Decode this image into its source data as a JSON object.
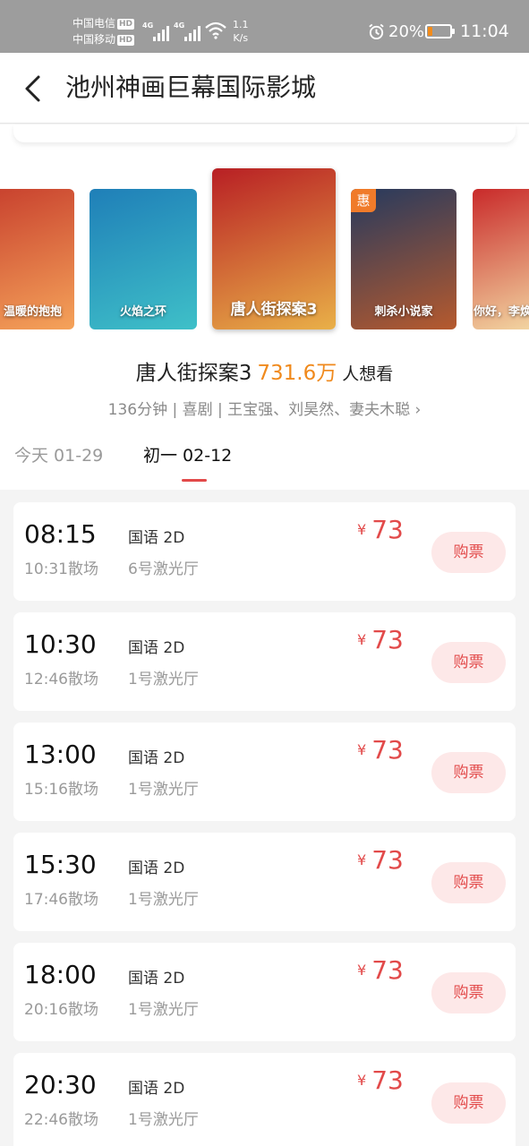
{
  "status_bar": {
    "carrier1": "中国电信",
    "carrier2": "中国移动",
    "hd": "HD",
    "net1": "4G",
    "net2": "4G",
    "speed_value": "1.1",
    "speed_unit": "K/s",
    "battery_pct": "20%",
    "battery_level": 0.2,
    "time": "11:04"
  },
  "header": {
    "title": "池州神画巨幕国际影城"
  },
  "posters": [
    {
      "label": "温暖的抱抱",
      "color1": "#c8412e",
      "color2": "#f5a35a"
    },
    {
      "label": "火焰之环",
      "color1": "#1f7fb8",
      "color2": "#3fc0c8"
    },
    {
      "label": "唐人街探案3",
      "color1": "#b81f24",
      "color2": "#e9b048"
    },
    {
      "label": "刺杀小说家",
      "color1": "#263a5e",
      "color2": "#b65a2e",
      "badge": "惠"
    },
    {
      "label": "你好，李焕英",
      "color1": "#c92a2a",
      "color2": "#f3d9a4"
    }
  ],
  "movie": {
    "name": "唐人街探案3",
    "want_count": "731.6万",
    "want_label": "人想看",
    "info": "136分钟 | 喜剧 | 王宝强、刘昊然、妻夫木聪 ›"
  },
  "date_tabs": [
    {
      "label": "今天 01-29",
      "active": false
    },
    {
      "label": "初一 02-12",
      "active": true
    }
  ],
  "showtimes": [
    {
      "start": "08:15",
      "end": "10:31散场",
      "lang": "国语 2D",
      "hall": "6号激光厅",
      "currency": "¥",
      "price": "73",
      "buy": "购票"
    },
    {
      "start": "10:30",
      "end": "12:46散场",
      "lang": "国语 2D",
      "hall": "1号激光厅",
      "currency": "¥",
      "price": "73",
      "buy": "购票"
    },
    {
      "start": "13:00",
      "end": "15:16散场",
      "lang": "国语 2D",
      "hall": "1号激光厅",
      "currency": "¥",
      "price": "73",
      "buy": "购票"
    },
    {
      "start": "15:30",
      "end": "17:46散场",
      "lang": "国语 2D",
      "hall": "1号激光厅",
      "currency": "¥",
      "price": "73",
      "buy": "购票"
    },
    {
      "start": "18:00",
      "end": "20:16散场",
      "lang": "国语 2D",
      "hall": "1号激光厅",
      "currency": "¥",
      "price": "73",
      "buy": "购票"
    },
    {
      "start": "20:30",
      "end": "22:46散场",
      "lang": "国语 2D",
      "hall": "1号激光厅",
      "currency": "¥",
      "price": "73",
      "buy": "购票"
    }
  ],
  "colors": {
    "accent": "#e24a4a",
    "want_orange": "#f08a1d",
    "badge": "#f07b2a"
  }
}
